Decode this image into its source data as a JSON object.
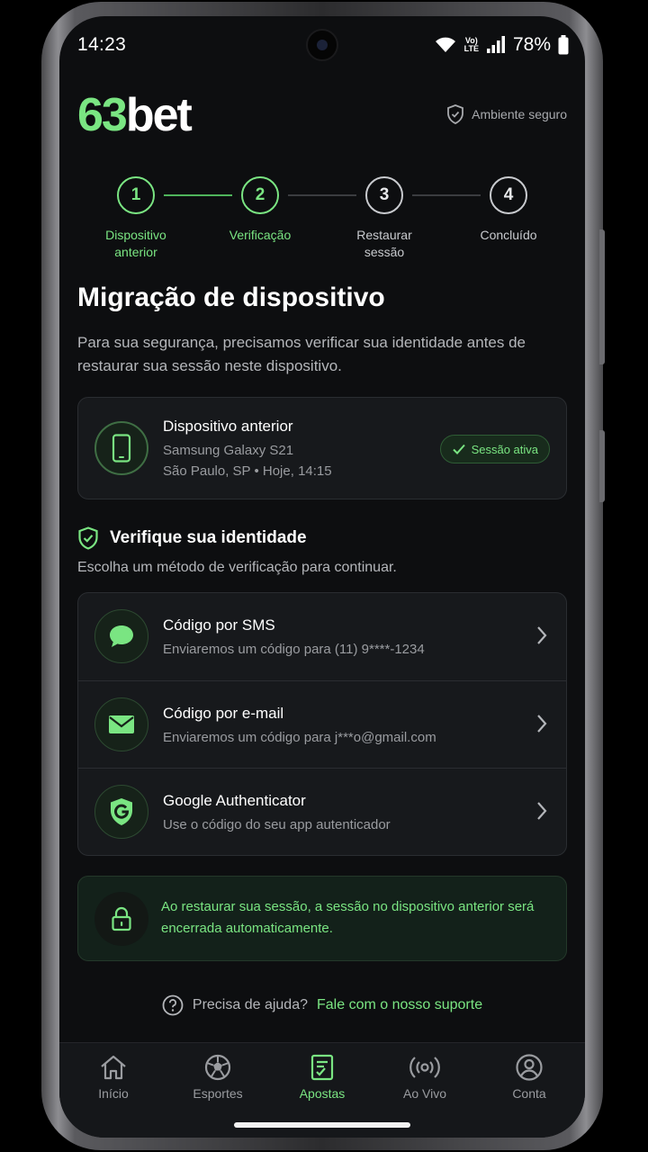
{
  "status_bar": {
    "time": "14:23",
    "network": "LTE",
    "battery": "78%"
  },
  "header": {
    "brand_number": "63",
    "brand_text": "bet",
    "secure_label": "Ambiente seguro"
  },
  "stepper": {
    "steps": [
      {
        "number": "1",
        "label": "Dispositivo anterior",
        "state": "done"
      },
      {
        "number": "2",
        "label": "Verificação",
        "state": "done"
      },
      {
        "number": "3",
        "label": "Restaurar sessão",
        "state": "pending"
      },
      {
        "number": "4",
        "label": "Concluído",
        "state": "pending"
      }
    ]
  },
  "page": {
    "title": "Migração de dispositivo",
    "intro": "Para sua segurança, precisamos verificar sua identidade antes de restaurar sua sessão neste dispositivo."
  },
  "device_card": {
    "title": "Dispositivo anterior",
    "model": "Samsung Galaxy S21",
    "location": "São Paulo, SP • Hoje, 14:15",
    "badge": "Sessão ativa",
    "icon": "smartphone-icon"
  },
  "verify": {
    "title": "Verifique sua identidade",
    "subtitle": "Escolha um método de verificação para continuar.",
    "methods": [
      {
        "title": "Código por SMS",
        "subtitle": "Enviaremos um código para (11) 9****-1234",
        "icon": "chat-bubble-icon"
      },
      {
        "title": "Código por e-mail",
        "subtitle": "Enviaremos um código para j***o@gmail.com",
        "icon": "envelope-icon"
      },
      {
        "title": "Google Authenticator",
        "subtitle": "Use o código do seu app autenticador",
        "icon": "google-shield-icon"
      }
    ]
  },
  "notice": {
    "text": "Ao restaurar sua sessão, a sessão no dispositivo anterior será encerrada automaticamente.",
    "icon": "lock-icon"
  },
  "help": {
    "question": "Precisa de ajuda?",
    "link": "Fale com o nosso suporte"
  },
  "bottom_nav": {
    "active": "Apostas",
    "items": [
      {
        "label": "Início",
        "icon": "home-icon"
      },
      {
        "label": "Esportes",
        "icon": "soccer-ball-icon"
      },
      {
        "label": "Apostas",
        "icon": "bet-slip-icon"
      },
      {
        "label": "Ao Vivo",
        "icon": "broadcast-icon"
      },
      {
        "label": "Conta",
        "icon": "user-icon"
      }
    ]
  },
  "colors": {
    "accent": "#7ae582",
    "background": "#0d0e10",
    "card": "#17191c"
  }
}
